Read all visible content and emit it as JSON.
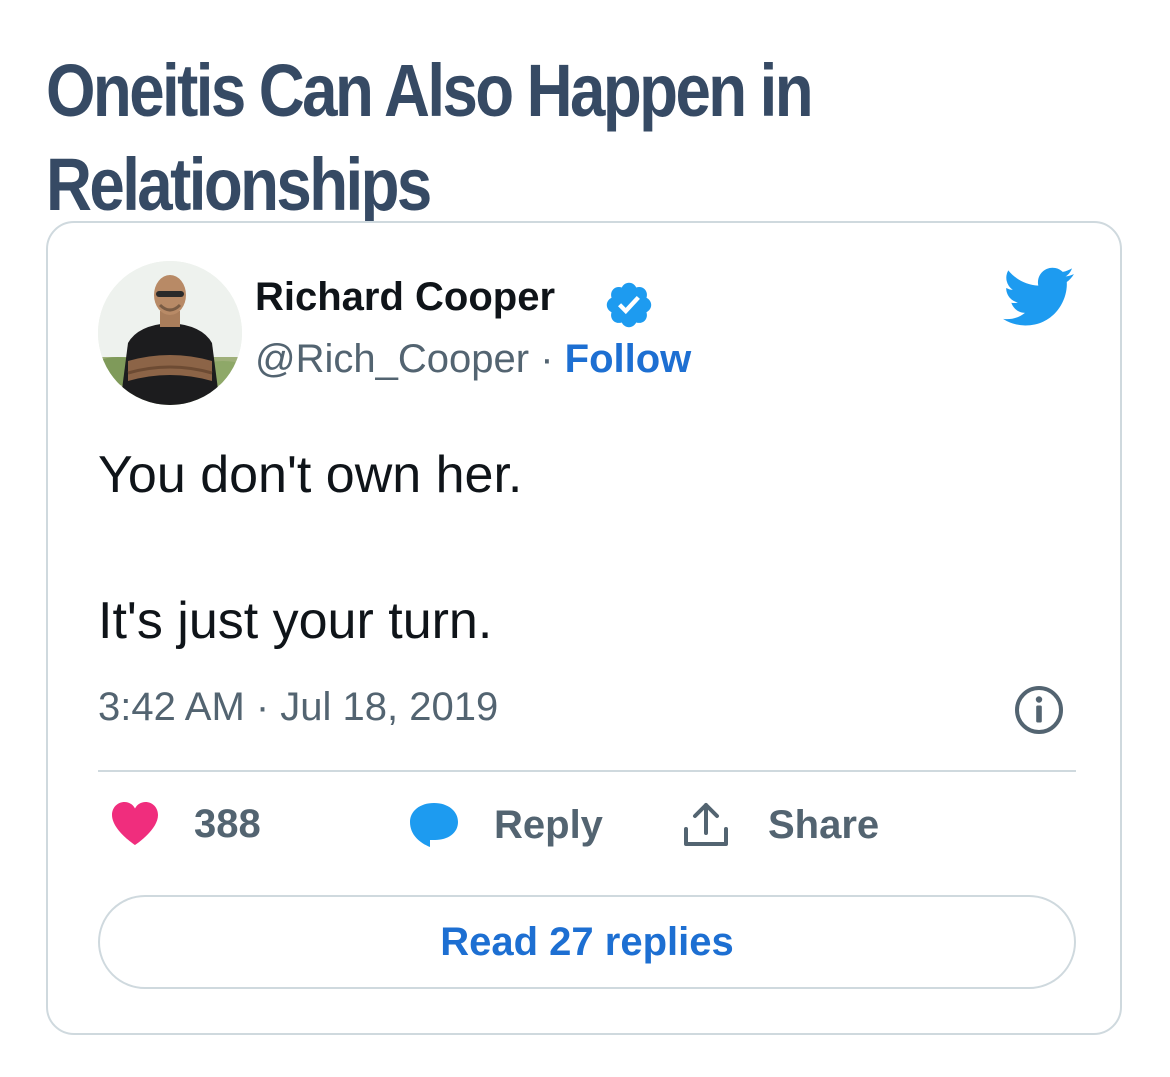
{
  "headline": "Oneitis Can Also Happen in Relationships",
  "tweet": {
    "author_name": "Richard Cooper",
    "handle": "@Rich_Cooper",
    "separator": "·",
    "follow_label": "Follow",
    "text_lines": [
      "You don't own her.",
      "It's just your turn."
    ],
    "timestamp": "3:42 AM · Jul 18, 2019",
    "likes": "388",
    "reply_label": "Reply",
    "share_label": "Share",
    "read_replies_label": "Read 27 replies"
  },
  "colors": {
    "headline": "#364a64",
    "link_blue": "#1d6fd2",
    "twitter_blue": "#1d9bf0",
    "heart": "#f02d7d",
    "muted": "#536471",
    "border": "#cfd9de"
  },
  "icons": {
    "verified": "verified-badge-icon",
    "brand": "twitter-bird-icon",
    "info": "info-icon",
    "like": "heart-icon",
    "reply": "speech-bubble-icon",
    "share": "upload-share-icon"
  }
}
